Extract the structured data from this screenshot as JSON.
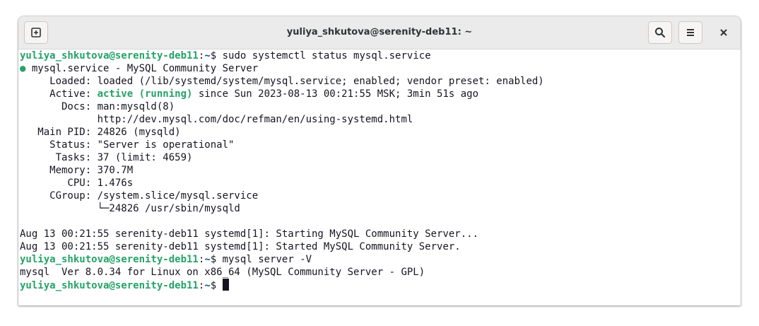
{
  "window": {
    "title": "yuliya_shkutova@serenity-deb11: ~"
  },
  "icons": {
    "new_tab": "new-tab-icon",
    "search": "search-icon",
    "menu": "hamburger-menu-icon",
    "close": "close-icon"
  },
  "colors": {
    "prompt_user": "#26a269",
    "prompt_path": "#12488b",
    "active_status": "#26a269",
    "text": "#171421"
  },
  "terminal": {
    "prompt_user": "yuliya_shkutova@serenity-deb11",
    "prompt_path": "~",
    "prompt_symbol": "$",
    "cmd1": " sudo systemctl status mysql.service",
    "bullet": "●",
    "service_line": " mysql.service - MySQL Community Server",
    "loaded": "     Loaded: loaded (/lib/systemd/system/mysql.service; enabled; vendor preset: enabled)",
    "active_label": "     Active: ",
    "active_status": "active (running)",
    "active_rest": " since Sun 2023-08-13 00:21:55 MSK; 3min 51s ago",
    "docs": "       Docs: man:mysqld(8)",
    "docs2": "             http://dev.mysql.com/doc/refman/en/using-systemd.html",
    "main_pid": "   Main PID: 24826 (mysqld)",
    "status": "     Status: \"Server is operational\"",
    "tasks": "      Tasks: 37 (limit: 4659)",
    "memory": "     Memory: 370.7M",
    "cpu": "        CPU: 1.476s",
    "cgroup": "     CGroup: /system.slice/mysql.service",
    "cgroup2": "             └─24826 /usr/sbin/mysqld",
    "log1": "Aug 13 00:21:55 serenity-deb11 systemd[1]: Starting MySQL Community Server...",
    "log2": "Aug 13 00:21:55 serenity-deb11 systemd[1]: Started MySQL Community Server.",
    "cmd2": " mysql server -V",
    "version": "mysql  Ver 8.0.34 for Linux on x86_64 (MySQL Community Server - GPL)"
  }
}
